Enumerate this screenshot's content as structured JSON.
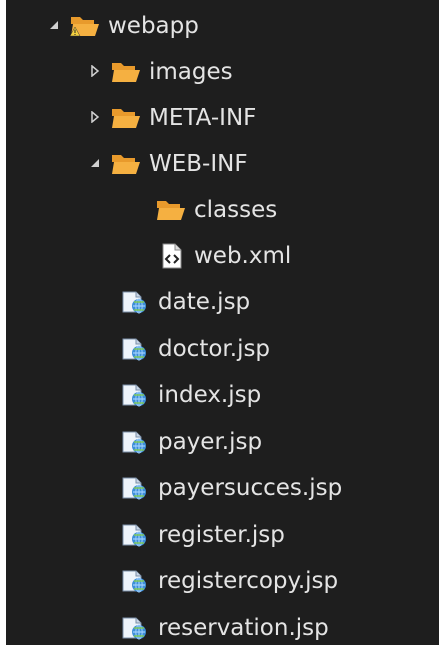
{
  "colors": {
    "background": "#1e1e1e",
    "text": "#e4e4e4",
    "folder": "#f0a030",
    "twisty": "#d0d0d0"
  },
  "tree": {
    "root": {
      "label": "webapp",
      "expanded": true,
      "icon": "project-folder-warning-icon"
    },
    "images": {
      "label": "images",
      "expanded": false,
      "icon": "folder-icon"
    },
    "meta_inf": {
      "label": "META-INF",
      "expanded": false,
      "icon": "folder-icon"
    },
    "web_inf": {
      "label": "WEB-INF",
      "expanded": true,
      "icon": "folder-open-icon"
    },
    "classes": {
      "label": "classes",
      "icon": "folder-icon"
    },
    "web_xml": {
      "label": "web.xml",
      "icon": "xml-file-icon"
    },
    "files": [
      {
        "label": "date.jsp",
        "icon": "jsp-file-icon"
      },
      {
        "label": "doctor.jsp",
        "icon": "jsp-file-icon"
      },
      {
        "label": "index.jsp",
        "icon": "jsp-file-icon"
      },
      {
        "label": "payer.jsp",
        "icon": "jsp-file-icon"
      },
      {
        "label": "payersucces.jsp",
        "icon": "jsp-file-icon"
      },
      {
        "label": "register.jsp",
        "icon": "jsp-file-icon"
      },
      {
        "label": "registercopy.jsp",
        "icon": "jsp-file-icon"
      },
      {
        "label": "reservation.jsp",
        "icon": "jsp-file-icon"
      }
    ]
  }
}
